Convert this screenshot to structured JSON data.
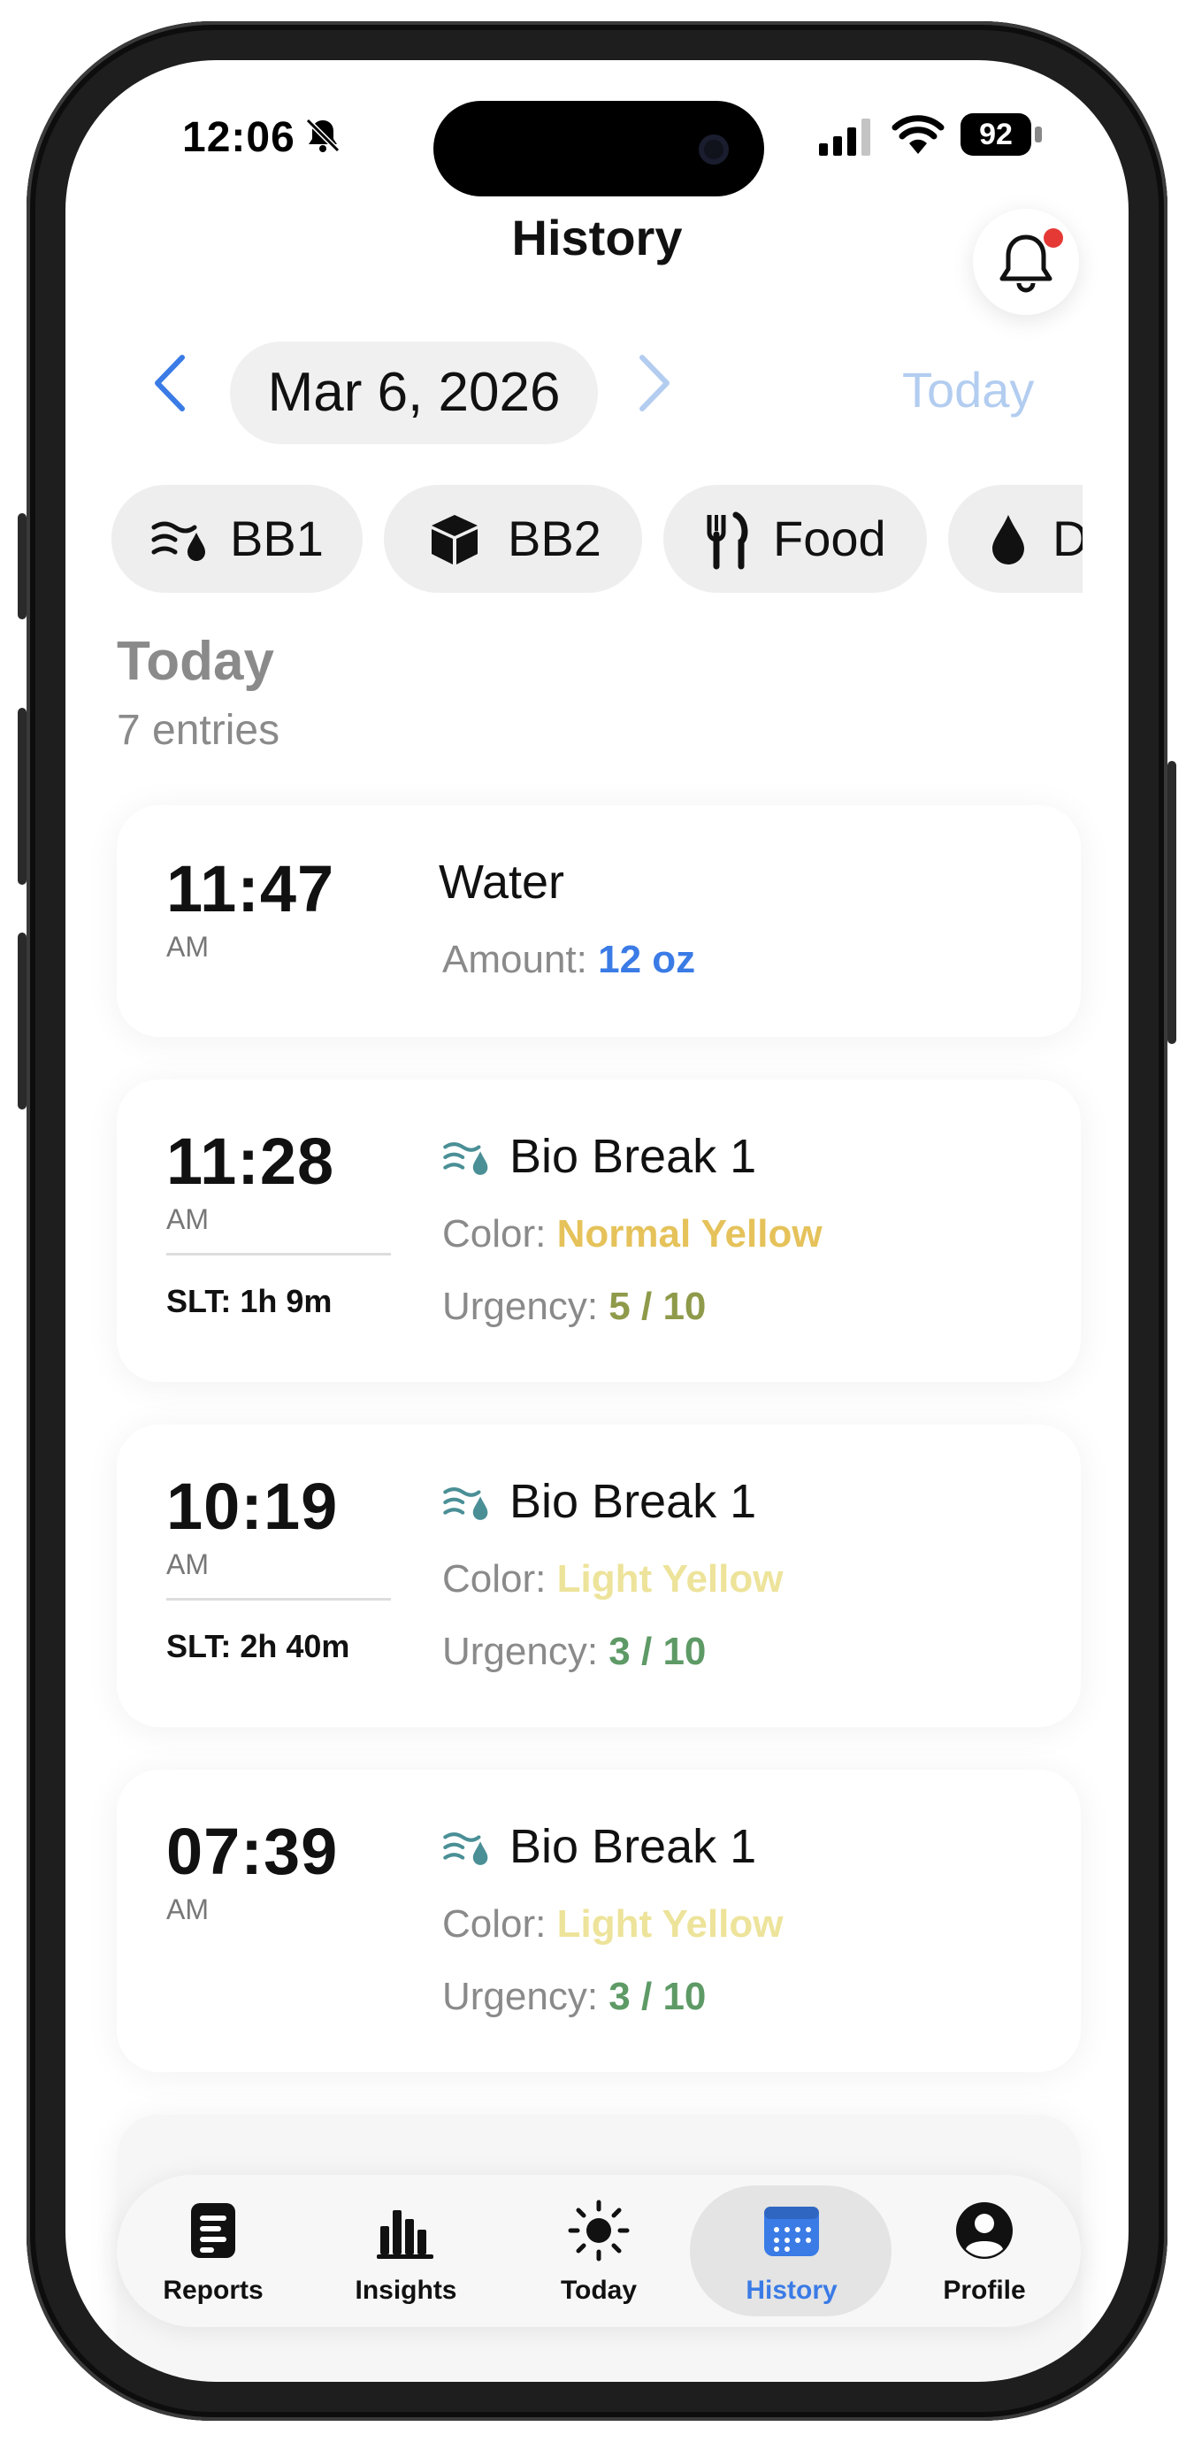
{
  "status_bar": {
    "time": "12:06",
    "battery": "92",
    "icons": [
      "bell-slash-icon",
      "signal-icon",
      "wifi-icon",
      "battery-icon"
    ]
  },
  "header": {
    "title": "History",
    "bell_icon": "bell-icon",
    "notification_color": "#e53935"
  },
  "date_nav": {
    "date": "Mar 6, 2026",
    "today_label": "Today",
    "prev_icon": "chevron-left-icon",
    "next_icon": "chevron-right-icon"
  },
  "filters": [
    {
      "label": "BB1",
      "icon": "wind-drop-icon"
    },
    {
      "label": "BB2",
      "icon": "cube-icon"
    },
    {
      "label": "Food",
      "icon": "fork-knife-icon"
    },
    {
      "label": "D",
      "icon": "drop-icon"
    }
  ],
  "section": {
    "title": "Today",
    "subtitle": "7 entries"
  },
  "entries": [
    {
      "time": "11:47",
      "ampm": "AM",
      "title": "Water",
      "detail1_label": "Amount: ",
      "detail1_value": "12 oz",
      "detail1_color": "#3a7be6"
    },
    {
      "time": "11:28",
      "ampm": "AM",
      "slt": "SLT: 1h 9m",
      "title": "Bio Break 1",
      "icon": "wind-drop-icon",
      "detail1_label": "Color: ",
      "detail1_value": "Normal Yellow",
      "detail1_color": "#e5c25a",
      "detail2_label": "Urgency: ",
      "detail2_value": "5 / 10",
      "detail2_color": "#8f9a4a"
    },
    {
      "time": "10:19",
      "ampm": "AM",
      "slt": "SLT: 2h 40m",
      "title": "Bio Break 1",
      "icon": "wind-drop-icon",
      "detail1_label": "Color: ",
      "detail1_value": "Light Yellow",
      "detail1_color": "#ede39a",
      "detail2_label": "Urgency: ",
      "detail2_value": "3 / 10",
      "detail2_color": "#5e9a66"
    },
    {
      "time": "07:39",
      "ampm": "AM",
      "title": "Bio Break 1",
      "icon": "wind-drop-icon",
      "detail1_label": "Color: ",
      "detail1_value": "Light Yellow",
      "detail1_color": "#ede39a",
      "detail2_label": "Urgency: ",
      "detail2_value": "3 / 10",
      "detail2_color": "#5e9a66"
    }
  ],
  "tabbar": {
    "tabs": [
      {
        "label": "Reports",
        "icon": "document-icon"
      },
      {
        "label": "Insights",
        "icon": "bar-chart-icon"
      },
      {
        "label": "Today",
        "icon": "sun-icon"
      },
      {
        "label": "History",
        "icon": "calendar-icon",
        "active": true
      },
      {
        "label": "Profile",
        "icon": "person-circle-icon"
      }
    ],
    "active_color": "#3a7be6"
  }
}
